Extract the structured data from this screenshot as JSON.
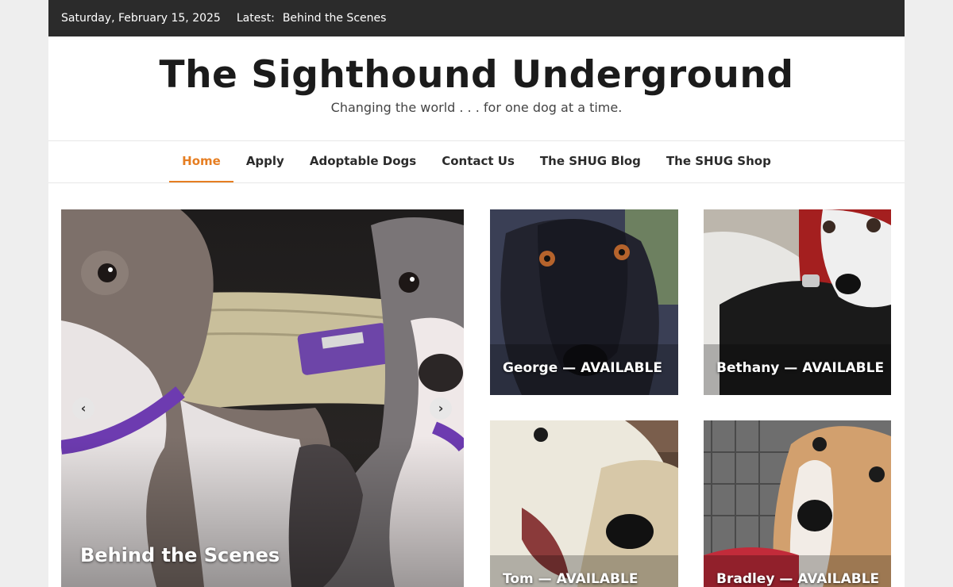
{
  "topbar": {
    "date": "Saturday, February 15, 2025",
    "latest_label": "Latest:",
    "latest_link": "Behind the Scenes"
  },
  "site": {
    "title": "The Sighthound Underground",
    "tagline": "Changing the world . . . for one dog at a time."
  },
  "nav": {
    "items": [
      {
        "label": "Home",
        "active": true
      },
      {
        "label": "Apply"
      },
      {
        "label": "Adoptable Dogs"
      },
      {
        "label": "Contact Us"
      },
      {
        "label": "The SHUG Blog"
      },
      {
        "label": "The SHUG Shop"
      }
    ]
  },
  "slider": {
    "title": "Behind the Scenes",
    "prev_icon": "chevron-left-icon",
    "next_icon": "chevron-right-icon"
  },
  "cards": [
    {
      "title": "George — AVAILABLE"
    },
    {
      "title": "Bethany — AVAILABLE"
    },
    {
      "title": "Tom — AVAILABLE"
    },
    {
      "title": "Bradley — AVAILABLE"
    }
  ],
  "colors": {
    "accent": "#e67e22",
    "topbar": "#2b2b2b",
    "page_bg": "#eeeeee"
  }
}
